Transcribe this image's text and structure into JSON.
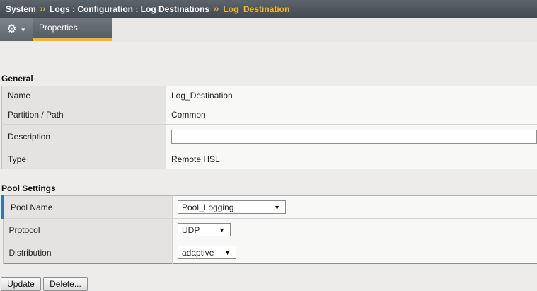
{
  "breadcrumb": {
    "items": [
      "System",
      "Logs : Configuration : Log Destinations"
    ],
    "current": "Log_Destination",
    "separator": "››"
  },
  "toolbar": {
    "gear_icon": "gear-icon",
    "tab_label": "Properties"
  },
  "general": {
    "title": "General",
    "name_label": "Name",
    "name_value": "Log_Destination",
    "partition_label": "Partition / Path",
    "partition_value": "Common",
    "description_label": "Description",
    "description_value": "",
    "type_label": "Type",
    "type_value": "Remote HSL"
  },
  "pool_settings": {
    "title": "Pool Settings",
    "pool_name_label": "Pool Name",
    "pool_name_value": "Pool_Logging",
    "protocol_label": "Protocol",
    "protocol_value": "UDP",
    "distribution_label": "Distribution",
    "distribution_value": "adaptive"
  },
  "actions": {
    "update_label": "Update",
    "delete_label": "Delete..."
  },
  "colors": {
    "accent": "#f5b521",
    "required_marker": "#3d73a8",
    "header_bg": "#4d545b"
  }
}
